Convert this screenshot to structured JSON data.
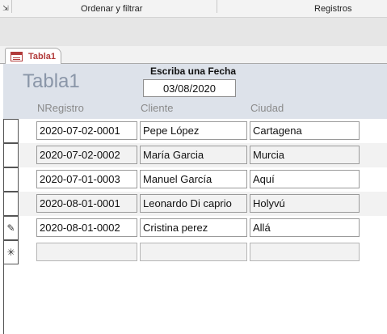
{
  "ribbon": {
    "groups": [
      {
        "label": "Ordenar y filtrar"
      },
      {
        "label": "Registros"
      }
    ],
    "launcher_icon": "dialog-launcher-icon"
  },
  "tab": {
    "label": "Tabla1",
    "icon": "form-icon"
  },
  "form": {
    "title": "Tabla1",
    "date_prompt": "Escriba una Fecha",
    "date_value": "03/08/2020",
    "columns": [
      "NRegistro",
      "Cliente",
      "Ciudad"
    ],
    "rows": [
      {
        "selector": "",
        "nregistro": "2020-07-02-0001",
        "cliente": "Pepe López",
        "ciudad": "Cartagena"
      },
      {
        "selector": "",
        "nregistro": "2020-07-02-0002",
        "cliente": "María Garcia",
        "ciudad": "Murcia"
      },
      {
        "selector": "",
        "nregistro": "2020-07-01-0003",
        "cliente": "Manuel García",
        "ciudad": "Aquí"
      },
      {
        "selector": "",
        "nregistro": "2020-08-01-0001",
        "cliente": "Leonardo Di caprio",
        "ciudad": "Holyvú"
      },
      {
        "selector": "✎",
        "nregistro": "2020-08-01-0002",
        "cliente": "Cristina perez",
        "ciudad": "Allá"
      },
      {
        "selector": "✳",
        "nregistro": "",
        "cliente": "",
        "ciudad": ""
      }
    ]
  },
  "colors": {
    "header_bg": "#dde2ea",
    "tab_accent": "#b23b3b",
    "title_color": "#8a96a8",
    "alt_row": "#f2f2f2"
  }
}
